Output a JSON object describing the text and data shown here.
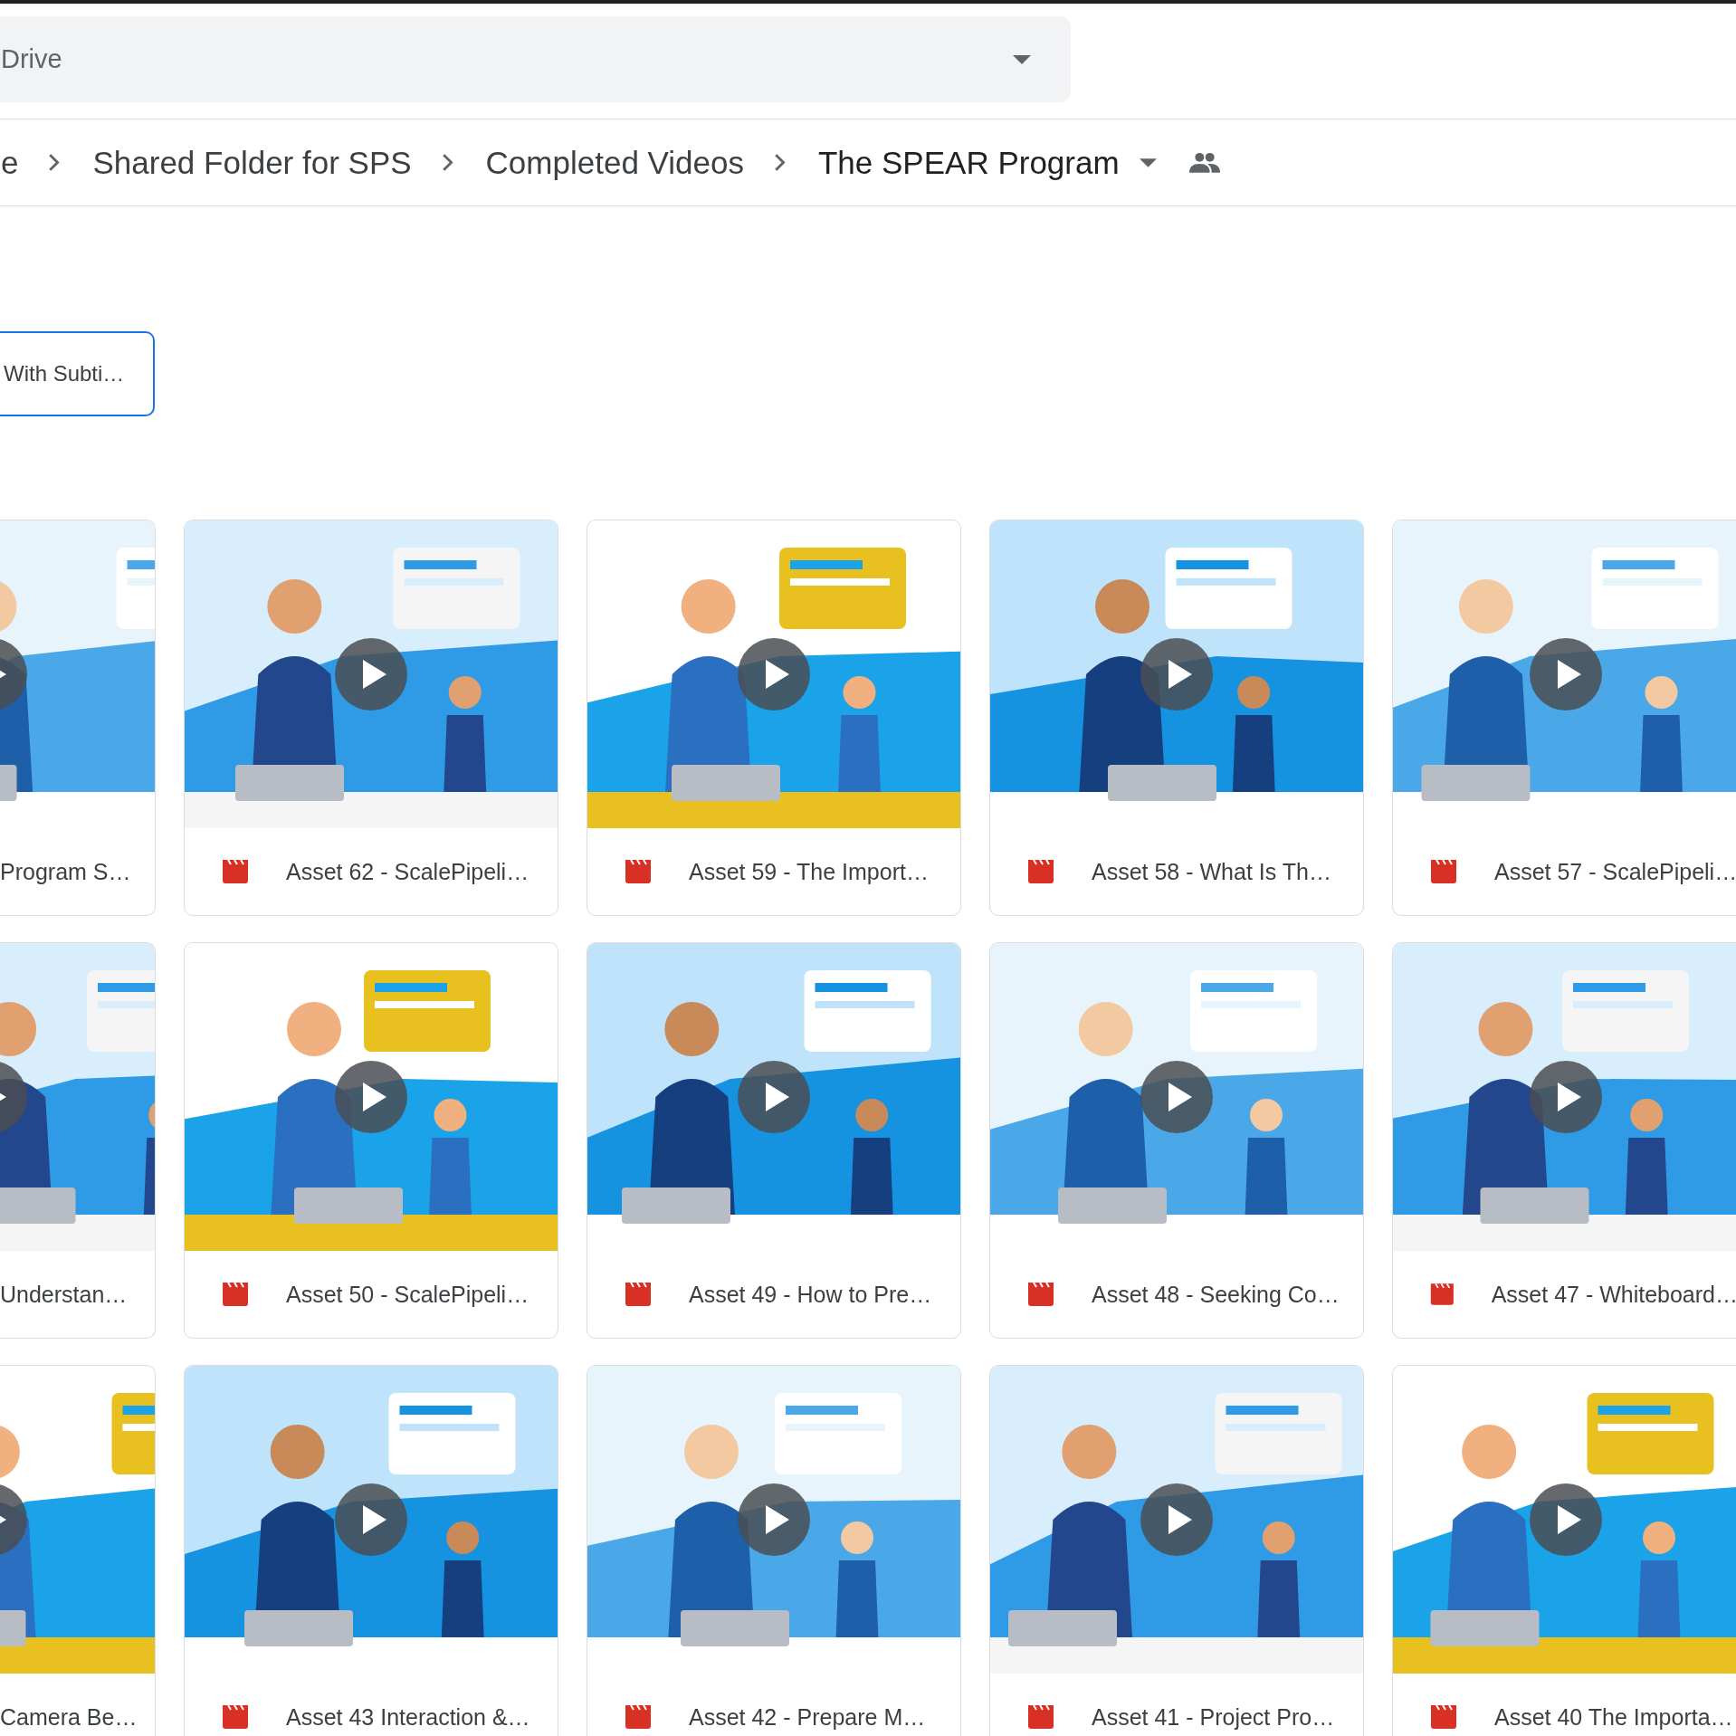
{
  "search": {
    "value": "Drive"
  },
  "breadcrumb": {
    "items": [
      "e",
      "Shared Folder for SPS",
      "Completed Videos"
    ],
    "current": "The SPEAR Program"
  },
  "chip": {
    "label": "With Subti…"
  },
  "files": [
    {
      "name": "Program S…"
    },
    {
      "name": "Asset 62 - ScalePipeli…"
    },
    {
      "name": "Asset 59 - The Import…"
    },
    {
      "name": "Asset 58 - What Is Th…"
    },
    {
      "name": "Asset 57 - ScalePipeli…"
    },
    {
      "name": "Understan…"
    },
    {
      "name": "Asset 50 - ScalePipeli…"
    },
    {
      "name": "Asset 49 - How to Pre…"
    },
    {
      "name": "Asset 48 - Seeking Co…"
    },
    {
      "name": "Asset 47 - Whiteboard…"
    },
    {
      "name": "Camera Be…"
    },
    {
      "name": "Asset 43 Interaction &…"
    },
    {
      "name": "Asset 42 - Prepare M…"
    },
    {
      "name": "Asset 41 - Project Pro…"
    },
    {
      "name": "Asset 40 The Importa…"
    }
  ]
}
